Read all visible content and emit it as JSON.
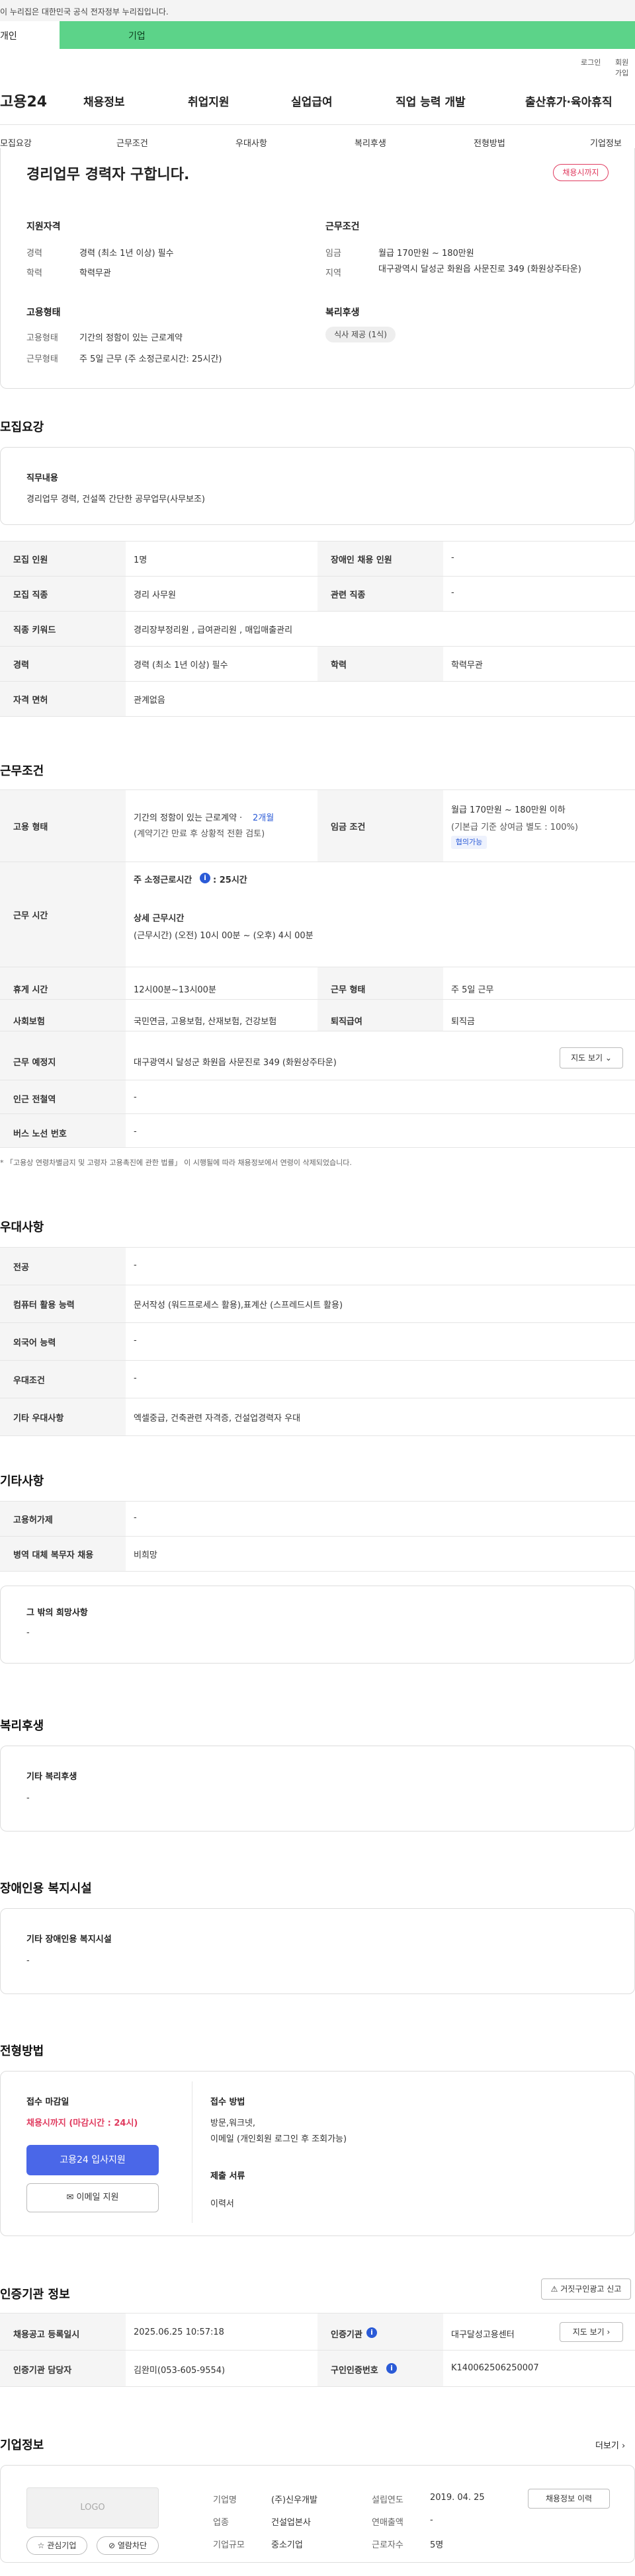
{
  "gov_banner": "이 누리집은 대한민국 공식 전자정부 누리집입니다.",
  "user_tabs": {
    "personal": "개인",
    "company": "기업"
  },
  "util": {
    "login": "로그인",
    "join": "회원가입"
  },
  "logo": "고용24",
  "gnb": [
    "채용정보",
    "취업지원",
    "실업급여",
    "직업 능력 개발",
    "출산휴가·육아휴직"
  ],
  "anchors": [
    "모집요강",
    "근무조건",
    "우대사항",
    "복리후생",
    "전형방법",
    "기업정보"
  ],
  "summary": {
    "title": "경리업무 경력자 구합니다.",
    "deadline_badge": "채용시까지",
    "qual_title": "지원자격",
    "career_label": "경력",
    "career_value": "경력 (최소 1년 이상) 필수",
    "edu_label": "학력",
    "edu_value": "학력무관",
    "cond_title": "근무조건",
    "wage_label": "임금",
    "wage_value": "월급 170만원 ~ 180만원",
    "area_label": "지역",
    "area_value": "대구광역시 달성군 화원읍 사문진로 349 (화원상주타운)",
    "emp_title": "고용형태",
    "emp_type_label": "고용형태",
    "emp_type_value": "기간의 정함이 있는 근로계약",
    "work_type_label": "근무형태",
    "work_type_value": "주 5일 근무 (주 소정근로시간: 25시간)",
    "welfare_title": "복리후생",
    "welfare_chip": "식사 제공 (1식)"
  },
  "recruit": {
    "section_title": "모집요강",
    "duty_title": "직무내용",
    "duty_text": "경리업무 경력, 건설쪽 간단한 공무업무(사무보조)",
    "rows": [
      {
        "th1": "모집 인원",
        "td1": "1명",
        "th2": "장애인 채용 인원",
        "td2": "-"
      },
      {
        "th1": "모집 직종",
        "td1": "경리 사무원",
        "th2": "관련 직종",
        "td2": "-"
      },
      {
        "th1": "직종 키워드",
        "td1": "경리장부정리원 , 급여관리원 , 매입매출관리",
        "th2": "",
        "td2": ""
      },
      {
        "th1": "경력",
        "td1": "경력 (최소 1년 이상) 필수",
        "th2": "학력",
        "td2": "학력무관"
      },
      {
        "th1": "자격 면허",
        "td1": "관계없음",
        "th2": "",
        "td2": ""
      }
    ]
  },
  "conditions": {
    "section_title": "근무조건",
    "emp_th": "고용 형태",
    "emp_td1": "기간의 정함이 있는 근로계약 ·",
    "emp_td1_months": "2개월",
    "emp_td2": "(계약기간 만료 후 상황적 전환 검토)",
    "wage_th": "임금 조건",
    "wage_td1": "월급 170만원 ~ 180만원 이하",
    "wage_td2": "(기본급 기준 상여금 별도 : 100%)",
    "wage_tag": "협의가능",
    "hours_th": "근무 시간",
    "hours_weekly": "주 소정근로시간",
    "hours_weekly_val": ": 25시간",
    "hours_detail_title": "상세 근무시간",
    "hours_detail": "(근무시간) (오전) 10시 00분 ~ (오후) 4시 00분",
    "rest_th": "휴게 시간",
    "rest_td": "12시00분~13시00분",
    "worktype_th": "근무 형태",
    "worktype_td": "주 5일 근무",
    "ins_th": "사회보험",
    "ins_td": "국민연금, 고용보험, 산재보험, 건강보험",
    "sev_th": "퇴직급여",
    "sev_td": "퇴직금",
    "place_th": "근무 예정지",
    "place_td": "대구광역시 달성군 화원읍 사문진로 349 (화원상주타운)",
    "map_btn": "지도 보기",
    "subway_th": "인근 전철역",
    "subway_td": "-",
    "bus_th": "버스 노선 번호",
    "bus_td": "-",
    "note": "* 「고용상 연령차별금지 및 고령자 고용촉진에 관한 법률」 이 시행될에 따라 채용정보에서 연령이 삭제되었습니다."
  },
  "preference": {
    "section_title": "우대사항",
    "rows": [
      {
        "th": "전공",
        "td": "-"
      },
      {
        "th": "컴퓨터 활용 능력",
        "td": "문서작성 (워드프로세스 활용),표계산 (스프레드시트 활용)"
      },
      {
        "th": "외국어 능력",
        "td": "-"
      },
      {
        "th": "우대조건",
        "td": "-"
      },
      {
        "th": "기타 우대사항",
        "td": "엑셀중급, 건축관련 자격증, 건설업경력자 우대"
      }
    ]
  },
  "other": {
    "section_title": "기타사항",
    "rows": [
      {
        "th": "고용허가제",
        "td": "-"
      },
      {
        "th": "병역 대체 복무자 채용",
        "td": "비희망"
      }
    ],
    "box_title": "그 밖의 희망사항",
    "box_text": "-"
  },
  "welfare": {
    "section_title": "복리후생",
    "box_title": "기타 복리후생",
    "box_text": "-"
  },
  "disabled": {
    "section_title": "장애인용 복지시설",
    "box_title": "기타 장애인용 복지시설",
    "box_text": "-"
  },
  "screening": {
    "section_title": "전형방법",
    "deadline_title": "접수 마감일",
    "deadline_value": "채용시까지 (마감시간 : 24시)",
    "apply_btn": "고용24 입사지원",
    "email_btn": "이메일 지원",
    "method_title": "접수 방법",
    "method_lines": [
      "방문,워크넷,",
      "이메일 (개인회원 로그인 후 조회가능)"
    ],
    "docs_title": "제출 서류",
    "docs_value": "이력서"
  },
  "cert": {
    "section_title": "인증기관 정보",
    "report_btn": "거짓구인광고 신고",
    "r1_th1": "채용공고 등록일시",
    "r1_td1": "2025.06.25 10:57:18",
    "r1_th2": "인증기관",
    "r1_td2": "대구달성고용센터",
    "map_btn": "지도 보기",
    "r2_th1": "인증기관 담당자",
    "r2_td1": "김완미(053-605-9554)",
    "r2_th2": "구인인증번호",
    "r2_td2": "K140062506250007"
  },
  "company": {
    "section_title": "기업정보",
    "more": "더보기",
    "logo_text": "LOGO",
    "fav_btn": "관심기업",
    "block_btn": "열람차단",
    "name_label": "기업명",
    "name_value": "(주)신우개발",
    "founded_label": "설립연도",
    "founded_value": "2019. 04. 25",
    "jobs_btn": "채용정보 이력",
    "industry_label": "업종",
    "industry_value": "건설업본사",
    "sales_label": "연매출액",
    "sales_value": "-",
    "size_label": "기업규모",
    "size_value": "중소기업",
    "employees_label": "근로자수",
    "employees_value": "5명"
  },
  "colors": {
    "accent": "#4a67e8",
    "green_tab": "#5cd389",
    "red": "#e03b5f",
    "blue": "#2b5bd7"
  }
}
